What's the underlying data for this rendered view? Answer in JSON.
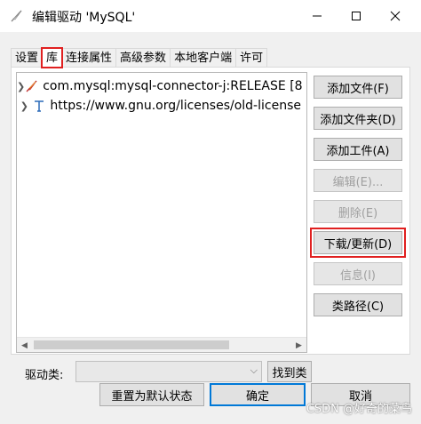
{
  "window": {
    "title": "编辑驱动 'MySQL'",
    "icon": "feather-icon"
  },
  "tabs": [
    {
      "label": "设置",
      "active": false
    },
    {
      "label": "库",
      "active": true
    },
    {
      "label": "连接属性",
      "active": false
    },
    {
      "label": "高级参数",
      "active": false
    },
    {
      "label": "本地客户端",
      "active": false
    },
    {
      "label": "许可",
      "active": false
    }
  ],
  "library_tree": [
    {
      "icon": "jar-feather-icon",
      "text": "com.mysql:mysql-connector-j:RELEASE [8"
    },
    {
      "icon": "text-t-icon",
      "text": "https://www.gnu.org/licenses/old-license"
    }
  ],
  "side_buttons": {
    "add_file": "添加文件(F)",
    "add_folder": "添加文件夹(D)",
    "add_artifact": "添加工件(A)",
    "edit": "编辑(E)...",
    "delete": "删除(E)",
    "download_update": "下载/更新(D)",
    "info": "信息(I)",
    "class_path": "类路径(C)"
  },
  "driver_class": {
    "label": "驱动类:",
    "value": "",
    "find_label": "找到类"
  },
  "bottom_buttons": {
    "reset": "重置为默认状态",
    "ok": "确定",
    "cancel": "取消"
  },
  "watermark": "CSDN @好奇的菜鸟",
  "colors": {
    "highlight_red": "#e02020",
    "default_focus": "#0078d7",
    "dialog_bg": "#f0f0f0"
  }
}
